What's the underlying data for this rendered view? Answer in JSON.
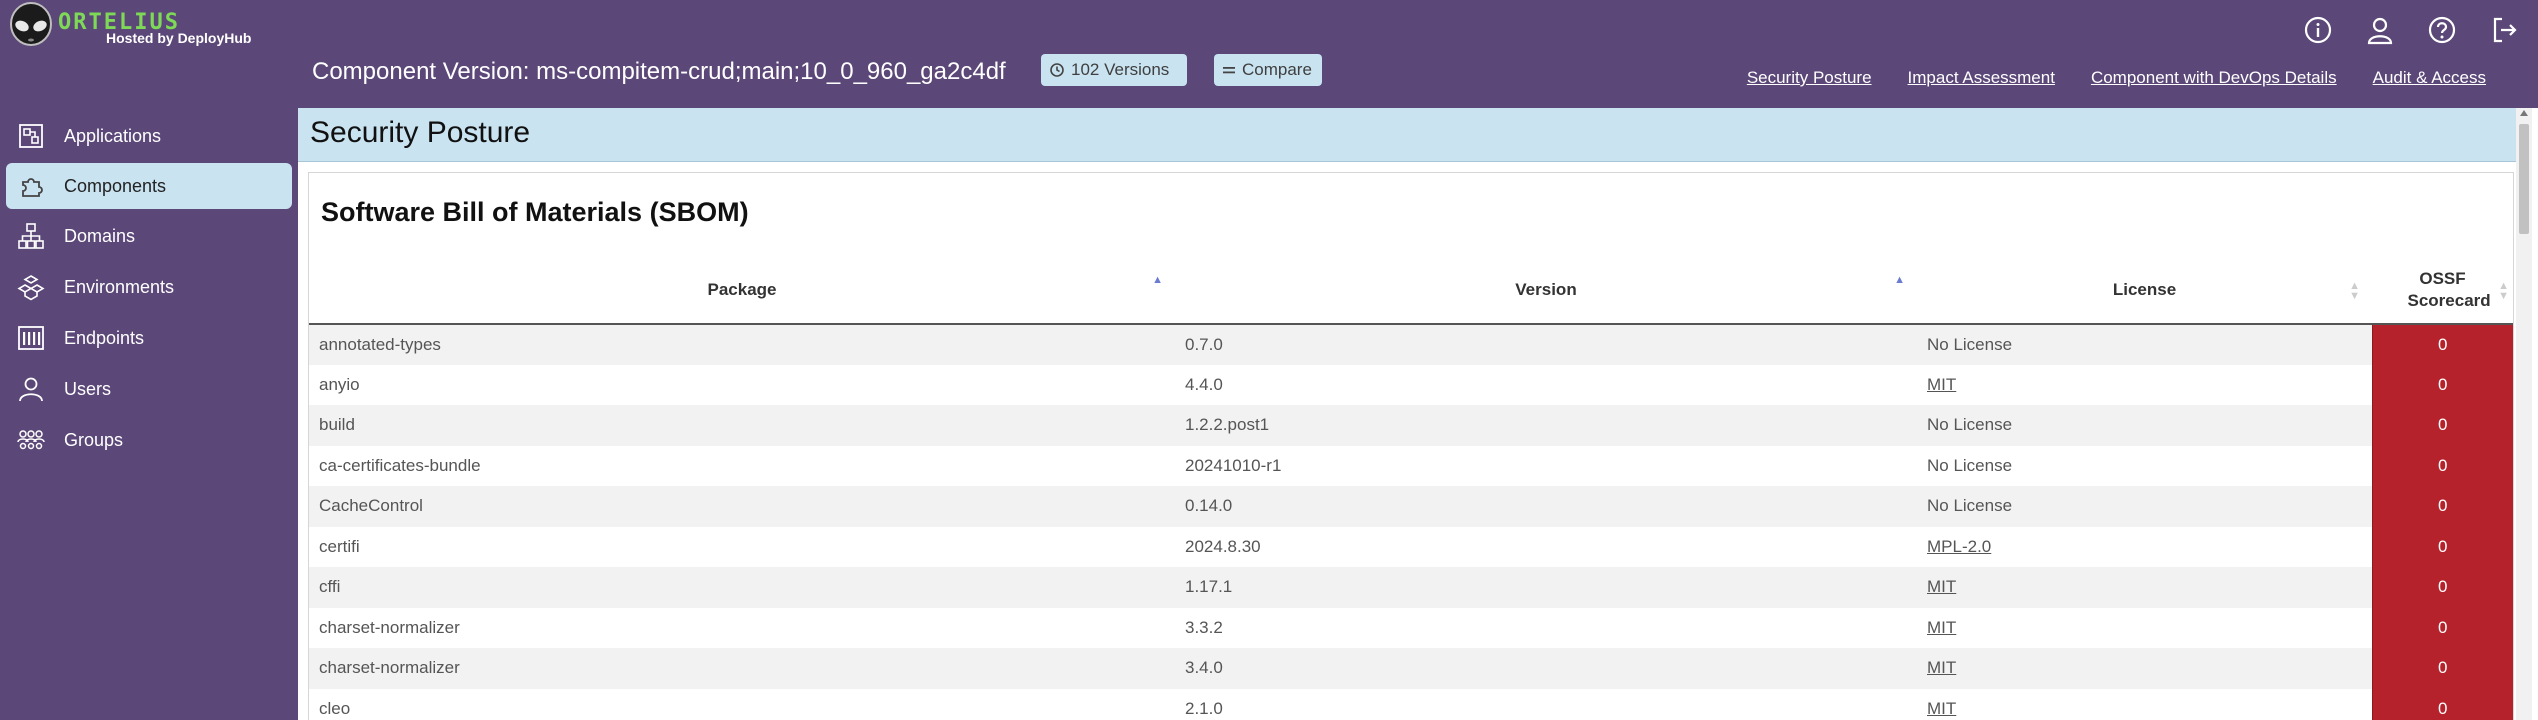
{
  "brand": {
    "logo_text": "ORTELIUS",
    "hosted_by": "Hosted by DeployHub"
  },
  "header": {
    "title": "Component Version: ms-compitem-crud;main;10_0_960_ga2c4df",
    "versions_label": "102 Versions",
    "compare_label": "Compare",
    "icons": [
      "info-icon",
      "user-icon",
      "help-icon",
      "logout-icon"
    ],
    "nav": [
      "Security Posture",
      "Impact Assessment",
      "Component with DevOps Details",
      "Audit & Access"
    ]
  },
  "sidebar": {
    "items": [
      {
        "label": "Applications",
        "icon": "applications-icon",
        "active": false
      },
      {
        "label": "Components",
        "icon": "components-icon",
        "active": true
      },
      {
        "label": "Domains",
        "icon": "domains-icon",
        "active": false
      },
      {
        "label": "Environments",
        "icon": "environments-icon",
        "active": false
      },
      {
        "label": "Endpoints",
        "icon": "endpoints-icon",
        "active": false
      },
      {
        "label": "Users",
        "icon": "users-icon",
        "active": false
      },
      {
        "label": "Groups",
        "icon": "groups-icon",
        "active": false
      }
    ]
  },
  "section": {
    "title": "Security Posture"
  },
  "sbom": {
    "title": "Software Bill of Materials (SBOM)",
    "columns": [
      "Package",
      "Version",
      "License",
      "OSSF Scorecard"
    ],
    "rows": [
      {
        "package": "annotated-types",
        "version": "0.7.0",
        "license": "No License",
        "license_link": false,
        "score": "0"
      },
      {
        "package": "anyio",
        "version": "4.4.0",
        "license": "MIT",
        "license_link": true,
        "score": "0"
      },
      {
        "package": "build",
        "version": "1.2.2.post1",
        "license": "No License",
        "license_link": false,
        "score": "0"
      },
      {
        "package": "ca-certificates-bundle",
        "version": "20241010-r1",
        "license": "No License",
        "license_link": false,
        "score": "0"
      },
      {
        "package": "CacheControl",
        "version": "0.14.0",
        "license": "No License",
        "license_link": false,
        "score": "0"
      },
      {
        "package": "certifi",
        "version": "2024.8.30",
        "license": "MPL-2.0",
        "license_link": true,
        "score": "0"
      },
      {
        "package": "cffi",
        "version": "1.17.1",
        "license": "MIT",
        "license_link": true,
        "score": "0"
      },
      {
        "package": "charset-normalizer",
        "version": "3.3.2",
        "license": "MIT",
        "license_link": true,
        "score": "0"
      },
      {
        "package": "charset-normalizer",
        "version": "3.4.0",
        "license": "MIT",
        "license_link": true,
        "score": "0"
      },
      {
        "package": "cleo",
        "version": "2.1.0",
        "license": "MIT",
        "license_link": true,
        "score": "0"
      }
    ]
  },
  "colors": {
    "chrome": "#5b4778",
    "accent": "#c9e3f1",
    "score_bad": "#b5222b"
  }
}
